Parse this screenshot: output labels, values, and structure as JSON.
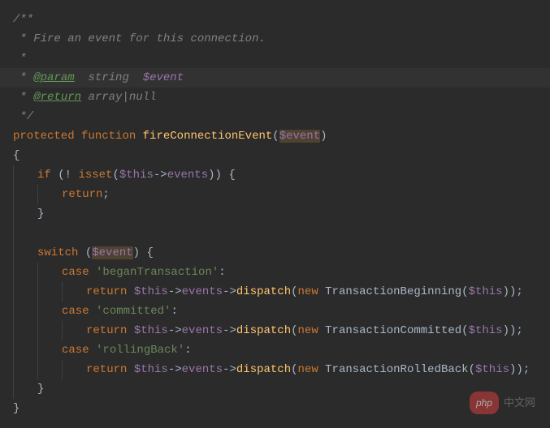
{
  "docblock": {
    "open": "/**",
    "desc_prefix": " * ",
    "desc": "Fire an event for this connection.",
    "empty": " *",
    "param_tag": "@param",
    "param_type": "string",
    "param_var": "$event",
    "return_tag": "@return",
    "return_type": "array",
    "return_pipe": "|",
    "return_null": "null",
    "close": " */"
  },
  "fn": {
    "visibility": "protected",
    "function_kw": "function",
    "name": "fireConnectionEvent",
    "lparen": "(",
    "param": "$event",
    "rparen": ")",
    "open_brace": "{",
    "close_brace": "}"
  },
  "guard": {
    "if_kw": "if",
    "neg": "!",
    "isset_kw": "isset",
    "this": "$this",
    "arrow": "->",
    "events": "events",
    "return_kw": "return",
    "semi": ";"
  },
  "switch": {
    "switch_kw": "switch",
    "var": "$event",
    "case_kw": "case",
    "cases": [
      {
        "label": "'beganTransaction'",
        "class": "TransactionBeginning"
      },
      {
        "label": "'committed'",
        "class": "TransactionCommitted"
      },
      {
        "label": "'rollingBack'",
        "class": "TransactionRolledBack"
      }
    ],
    "return_kw": "return",
    "this": "$this",
    "arrow": "->",
    "events": "events",
    "dispatch": "dispatch",
    "new_kw": "new",
    "colon": ":"
  },
  "watermark": {
    "badge": "php",
    "text": "中文网"
  }
}
